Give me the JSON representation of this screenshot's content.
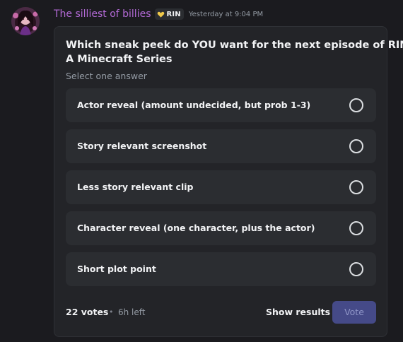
{
  "message": {
    "author": "The silliest of billies",
    "tag": {
      "text": "RIN",
      "icon": "heart-icon"
    },
    "timestamp": "Yesterday at 9:04 PM"
  },
  "poll": {
    "question_lines": [
      "Which sneak peek do YOU want for the next episode of RIN",
      "A Minecraft Series"
    ],
    "subtitle": "Select one answer",
    "answers": [
      {
        "label": "Actor reveal (amount undecided, but prob 1-3)",
        "selected": false
      },
      {
        "label": "Story relevant screenshot",
        "selected": false
      },
      {
        "label": "Less story relevant clip",
        "selected": false
      },
      {
        "label": "Character reveal (one character, plus the actor)",
        "selected": false
      },
      {
        "label": "Short plot point",
        "selected": false
      }
    ],
    "footer": {
      "votes": "22 votes",
      "separator": "•",
      "time_left": "6h left",
      "show_results_label": "Show results",
      "vote_label": "Vote"
    }
  },
  "colors": {
    "username": "#b36ad6",
    "vote_button": "#454a88",
    "tag_heart": "#f0c94a"
  }
}
